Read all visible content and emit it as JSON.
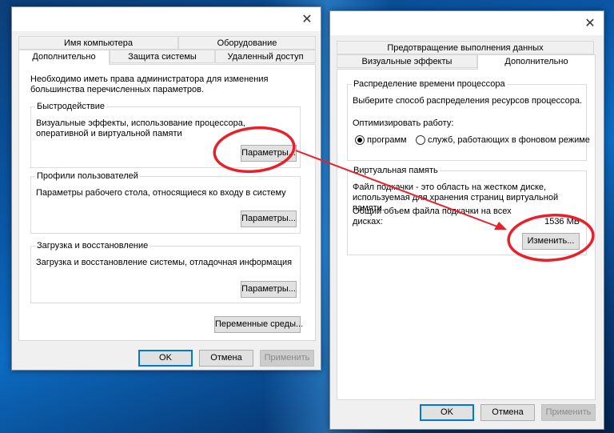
{
  "left_dialog": {
    "tabs_row1": [
      "Имя компьютера",
      "Оборудование"
    ],
    "tabs_row2": [
      "Дополнительно",
      "Защита системы",
      "Удаленный доступ"
    ],
    "note": "Необходимо иметь права администратора для изменения большинства перечисленных параметров.",
    "performance": {
      "title": "Быстродействие",
      "desc": "Визуальные эффекты, использование процессора, оперативной и виртуальной памяти",
      "button": "Параметры..."
    },
    "profiles": {
      "title": "Профили пользователей",
      "desc": "Параметры рабочего стола, относящиеся ко входу в систему",
      "button": "Параметры..."
    },
    "startup": {
      "title": "Загрузка и восстановление",
      "desc": "Загрузка и восстановление системы, отладочная информация",
      "button": "Параметры..."
    },
    "env_button": "Переменные среды...",
    "ok": "OK",
    "cancel": "Отмена",
    "apply": "Применить"
  },
  "right_dialog": {
    "tabs_row1": [
      "Предотвращение выполнения данных"
    ],
    "tabs_row2": [
      "Визуальные эффекты",
      "Дополнительно"
    ],
    "cpu": {
      "title": "Распределение времени процессора",
      "desc": "Выберите способ распределения ресурсов процессора.",
      "optimize_label": "Оптимизировать работу:",
      "option_programs": "программ",
      "option_services": "служб, работающих в фоновом режиме",
      "selected": "программ"
    },
    "vm": {
      "title": "Виртуальная память",
      "desc": "Файл подкачки - это область на жестком диске, используемая для хранения страниц виртуальной памяти.",
      "total_label": "Общий объем файла подкачки на всех дисках:",
      "total_value": "1536 МБ",
      "button": "Изменить..."
    },
    "ok": "OK",
    "cancel": "Отмена",
    "apply": "Применить"
  },
  "colors": {
    "annotation": "#e8202a",
    "focus": "#0078d7"
  }
}
